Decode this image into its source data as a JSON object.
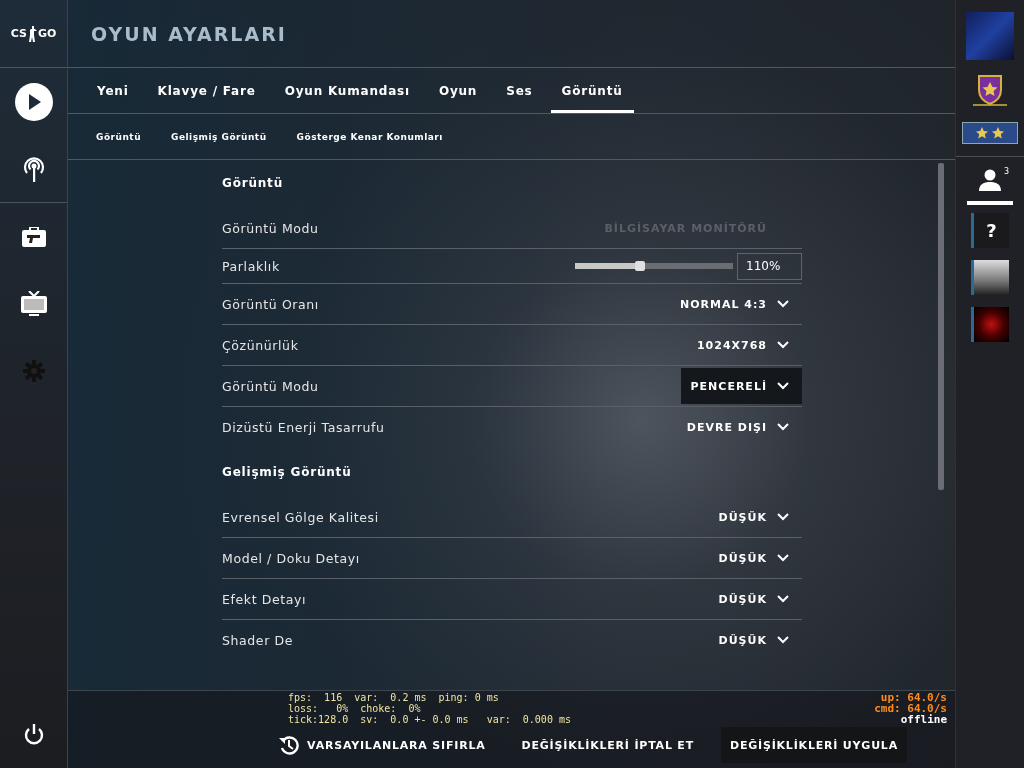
{
  "title": "OYUN AYARLARI",
  "tabs": [
    {
      "label": "Yeni",
      "selected": false
    },
    {
      "label": "Klavye / Fare",
      "selected": false
    },
    {
      "label": "Oyun Kumandası",
      "selected": false
    },
    {
      "label": "Oyun",
      "selected": false
    },
    {
      "label": "Ses",
      "selected": false
    },
    {
      "label": "Görüntü",
      "selected": true
    }
  ],
  "subtabs": [
    "Görüntü",
    "Gelişmiş Görüntü",
    "Gösterge Kenar Konumları"
  ],
  "sections": [
    {
      "title": "Görüntü",
      "rows": [
        {
          "kind": "static",
          "label": "Görüntü Modu",
          "value": "BİLGİSAYAR MONİTÖRÜ"
        },
        {
          "kind": "slider",
          "label": "Parlaklık",
          "level": 0.38,
          "value": "110%"
        },
        {
          "kind": "dropdown",
          "label": "Görüntü Oranı",
          "value": "NORMAL 4:3",
          "hovered": false
        },
        {
          "kind": "dropdown",
          "label": "Çözünürlük",
          "value": "1024X768",
          "hovered": false
        },
        {
          "kind": "dropdown",
          "label": "Görüntü Modu",
          "value": "PENCERELİ",
          "hovered": true
        },
        {
          "kind": "dropdown",
          "label": "Dizüstü Enerji Tasarrufu",
          "value": "DEVRE DIŞI",
          "hovered": false
        }
      ]
    },
    {
      "title": "Gelişmiş Görüntü",
      "rows": [
        {
          "kind": "dropdown",
          "label": "Evrensel Gölge Kalitesi",
          "value": "DÜŞÜK",
          "hovered": false
        },
        {
          "kind": "dropdown",
          "label": "Model / Doku Detayı",
          "value": "DÜŞÜK",
          "hovered": false
        },
        {
          "kind": "dropdown",
          "label": "Efekt Detayı",
          "value": "DÜŞÜK",
          "hovered": false
        },
        {
          "kind": "dropdown",
          "label": "Shader De",
          "value": "DÜŞÜK",
          "hovered": false
        }
      ]
    }
  ],
  "net_graph": {
    "left": [
      "fps:  116  var:  0.2 ms  ping: 0 ms",
      "loss:   0%  choke:  0%",
      "tick:128.0  sv:  0.0 +- 0.0 ms   var:  0.000 ms"
    ],
    "right": [
      {
        "text": "up: 64.0/s",
        "color": "#ff8c1a"
      },
      {
        "text": "cmd: 64.0/s",
        "color": "#ff8c1a"
      },
      {
        "text": "offline",
        "color": "#ffffff"
      }
    ]
  },
  "footer": {
    "reset": "VARSAYILANLARA SIFIRLA",
    "cancel": "DEĞİŞİKLİKLERİ İPTAL ET",
    "apply": "DEĞİŞİKLİKLERİ UYGULA"
  },
  "logo": {
    "left": "CS",
    "right": "GO"
  },
  "friends": {
    "count": "3",
    "list": [
      {
        "kind": "unknown",
        "text": "?"
      },
      {
        "kind": "photo"
      },
      {
        "kind": "image"
      }
    ]
  }
}
